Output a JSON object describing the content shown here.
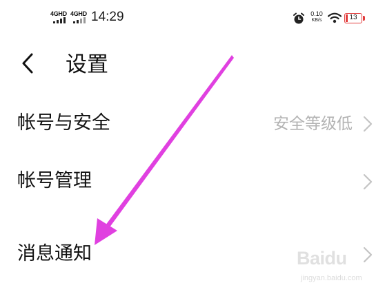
{
  "status_bar": {
    "sim1_network": "4GHD",
    "sim2_network": "4GHD",
    "time": "14:29",
    "net_speed_value": "0.10",
    "net_speed_unit": "KB/s",
    "battery_level": "13",
    "battery_color": "#e23b3b"
  },
  "header": {
    "title": "设置"
  },
  "settings": {
    "items": [
      {
        "label": "帐号与安全",
        "value": "安全等级低"
      },
      {
        "label": "帐号管理",
        "value": ""
      },
      {
        "label": "消息通知",
        "value": ""
      }
    ]
  },
  "annotation": {
    "arrow_color": "#e040e0"
  },
  "watermark": {
    "brand": "Baidu",
    "url": "jingyan.baidu.com"
  }
}
